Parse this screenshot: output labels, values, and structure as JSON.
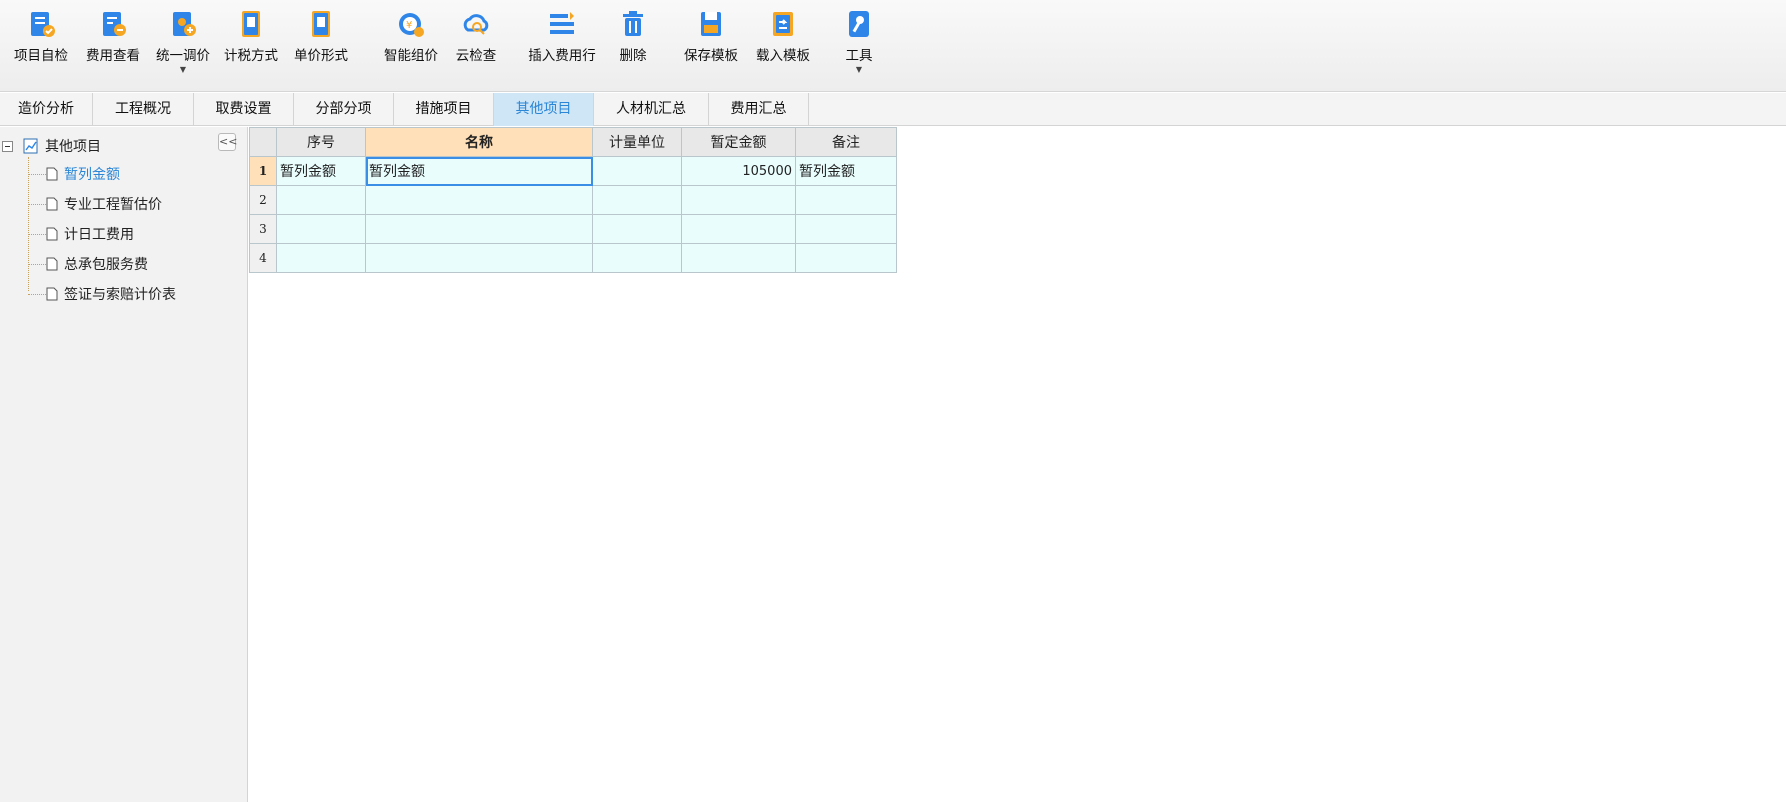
{
  "toolbar": {
    "buttons": [
      {
        "label": "项目自检",
        "icon": "clipboard-check-icon"
      },
      {
        "label": "费用查看",
        "icon": "document-search-icon"
      },
      {
        "label": "统一调价",
        "icon": "adjust-price-icon"
      },
      {
        "label": "计税方式",
        "icon": "tax-calculator-icon"
      },
      {
        "label": "单价形式",
        "icon": "unit-price-icon"
      },
      {
        "label": "智能组价",
        "icon": "smart-price-icon"
      },
      {
        "label": "云检查",
        "icon": "cloud-check-icon"
      },
      {
        "label": "插入费用行",
        "icon": "insert-row-icon"
      },
      {
        "label": "删除",
        "icon": "trash-icon"
      },
      {
        "label": "保存模板",
        "icon": "save-template-icon"
      },
      {
        "label": "载入模板",
        "icon": "load-template-icon"
      },
      {
        "label": "工具",
        "icon": "tools-icon"
      }
    ]
  },
  "tabs": [
    "造价分析",
    "工程概况",
    "取费设置",
    "分部分项",
    "措施项目",
    "其他项目",
    "人材机汇总",
    "费用汇总"
  ],
  "active_tab": "其他项目",
  "sidebar": {
    "collapse_label": "<<",
    "root": "其他项目",
    "items": [
      "暂列金额",
      "专业工程暂估价",
      "计日工费用",
      "总承包服务费",
      "签证与索赔计价表"
    ]
  },
  "grid": {
    "columns": [
      "序号",
      "名称",
      "计量单位",
      "暂定金额",
      "备注"
    ],
    "rows": [
      {
        "num": "1",
        "seq": "暂列金额",
        "name": "暂列金额",
        "unit": "",
        "amount": "105000",
        "note": "暂列金额"
      },
      {
        "num": "2",
        "seq": "",
        "name": "",
        "unit": "",
        "amount": "",
        "note": ""
      },
      {
        "num": "3",
        "seq": "",
        "name": "",
        "unit": "",
        "amount": "",
        "note": ""
      },
      {
        "num": "4",
        "seq": "",
        "name": "",
        "unit": "",
        "amount": "",
        "note": ""
      }
    ]
  },
  "colors": {
    "accent": "#2a86d6",
    "icon_blue": "#2f86e8",
    "icon_orange": "#f5a623",
    "selected_header": "#ffe0b8",
    "cell_bg": "#e9fdfd"
  }
}
